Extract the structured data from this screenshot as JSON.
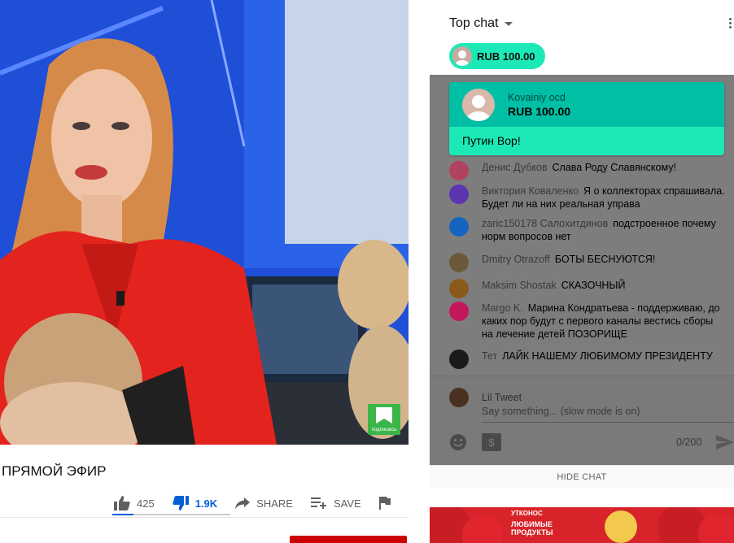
{
  "video": {
    "title": "ПРЯМОЙ ЭФИР",
    "watermark_text": "подпишись",
    "actions": {
      "likes": "425",
      "dislikes": "1.9K",
      "share_label": "SHARE",
      "save_label": "SAVE"
    },
    "like_ratio": 0.18
  },
  "chat": {
    "header_title": "Top chat",
    "ticker": {
      "amount": "RUB 100.00"
    },
    "super_chat": {
      "author": "Kovainiy ocd",
      "amount": "RUB 100.00",
      "message": "Путин Вор!"
    },
    "messages": [
      {
        "author": "Денис Дубков",
        "text": "Слава Роду Славянскому!",
        "avatar_color": "#b0435f"
      },
      {
        "author": "Виктория Коваленко",
        "text": "Я о коллекторах спрашивала. Будет ли на них реальная управа",
        "avatar_color": "#5e35b1"
      },
      {
        "author": "zaric150178 Салохитдинов",
        "text": "подстроенное почему норм вопросов нет",
        "avatar_color": "#1565c0"
      },
      {
        "author": "Dmitry Otrazoff",
        "text": "БОТЫ БЕСНУЮТСЯ!",
        "avatar_color": "#6b5a3a"
      },
      {
        "author": "Maksim Shostak",
        "text": "СКАЗОЧНЫЙ",
        "avatar_color": "#8a5a1a"
      },
      {
        "author": "Margo K.",
        "text": "Марина Кондратьева - поддерживаю, до каких пор будут с первого каналы вестись сборы на лечение детей ПОЗОРИЩЕ",
        "avatar_color": "#c2185b"
      },
      {
        "author": "Тет",
        "text": "ЛАЙК НАШЕМУ ЛЮБИМОМУ ПРЕЗИДЕНТУ",
        "avatar_color": "#1a1a1a"
      }
    ],
    "input": {
      "username": "Lil Tweet",
      "placeholder": "Say something... (slow mode is on)",
      "counter": "0/200"
    },
    "hide_chat_label": "HIDE CHAT"
  },
  "ad": {
    "brand": "УТКОНОС",
    "headline_1": "ЛЮБИМЫЕ",
    "headline_2": "ПРОДУКТЫ"
  },
  "colors": {
    "accent_blue": "#065fd4",
    "super_chat_dark": "#00bfa5",
    "super_chat_light": "#1de9b6",
    "subscribe_red": "#cc0000"
  }
}
